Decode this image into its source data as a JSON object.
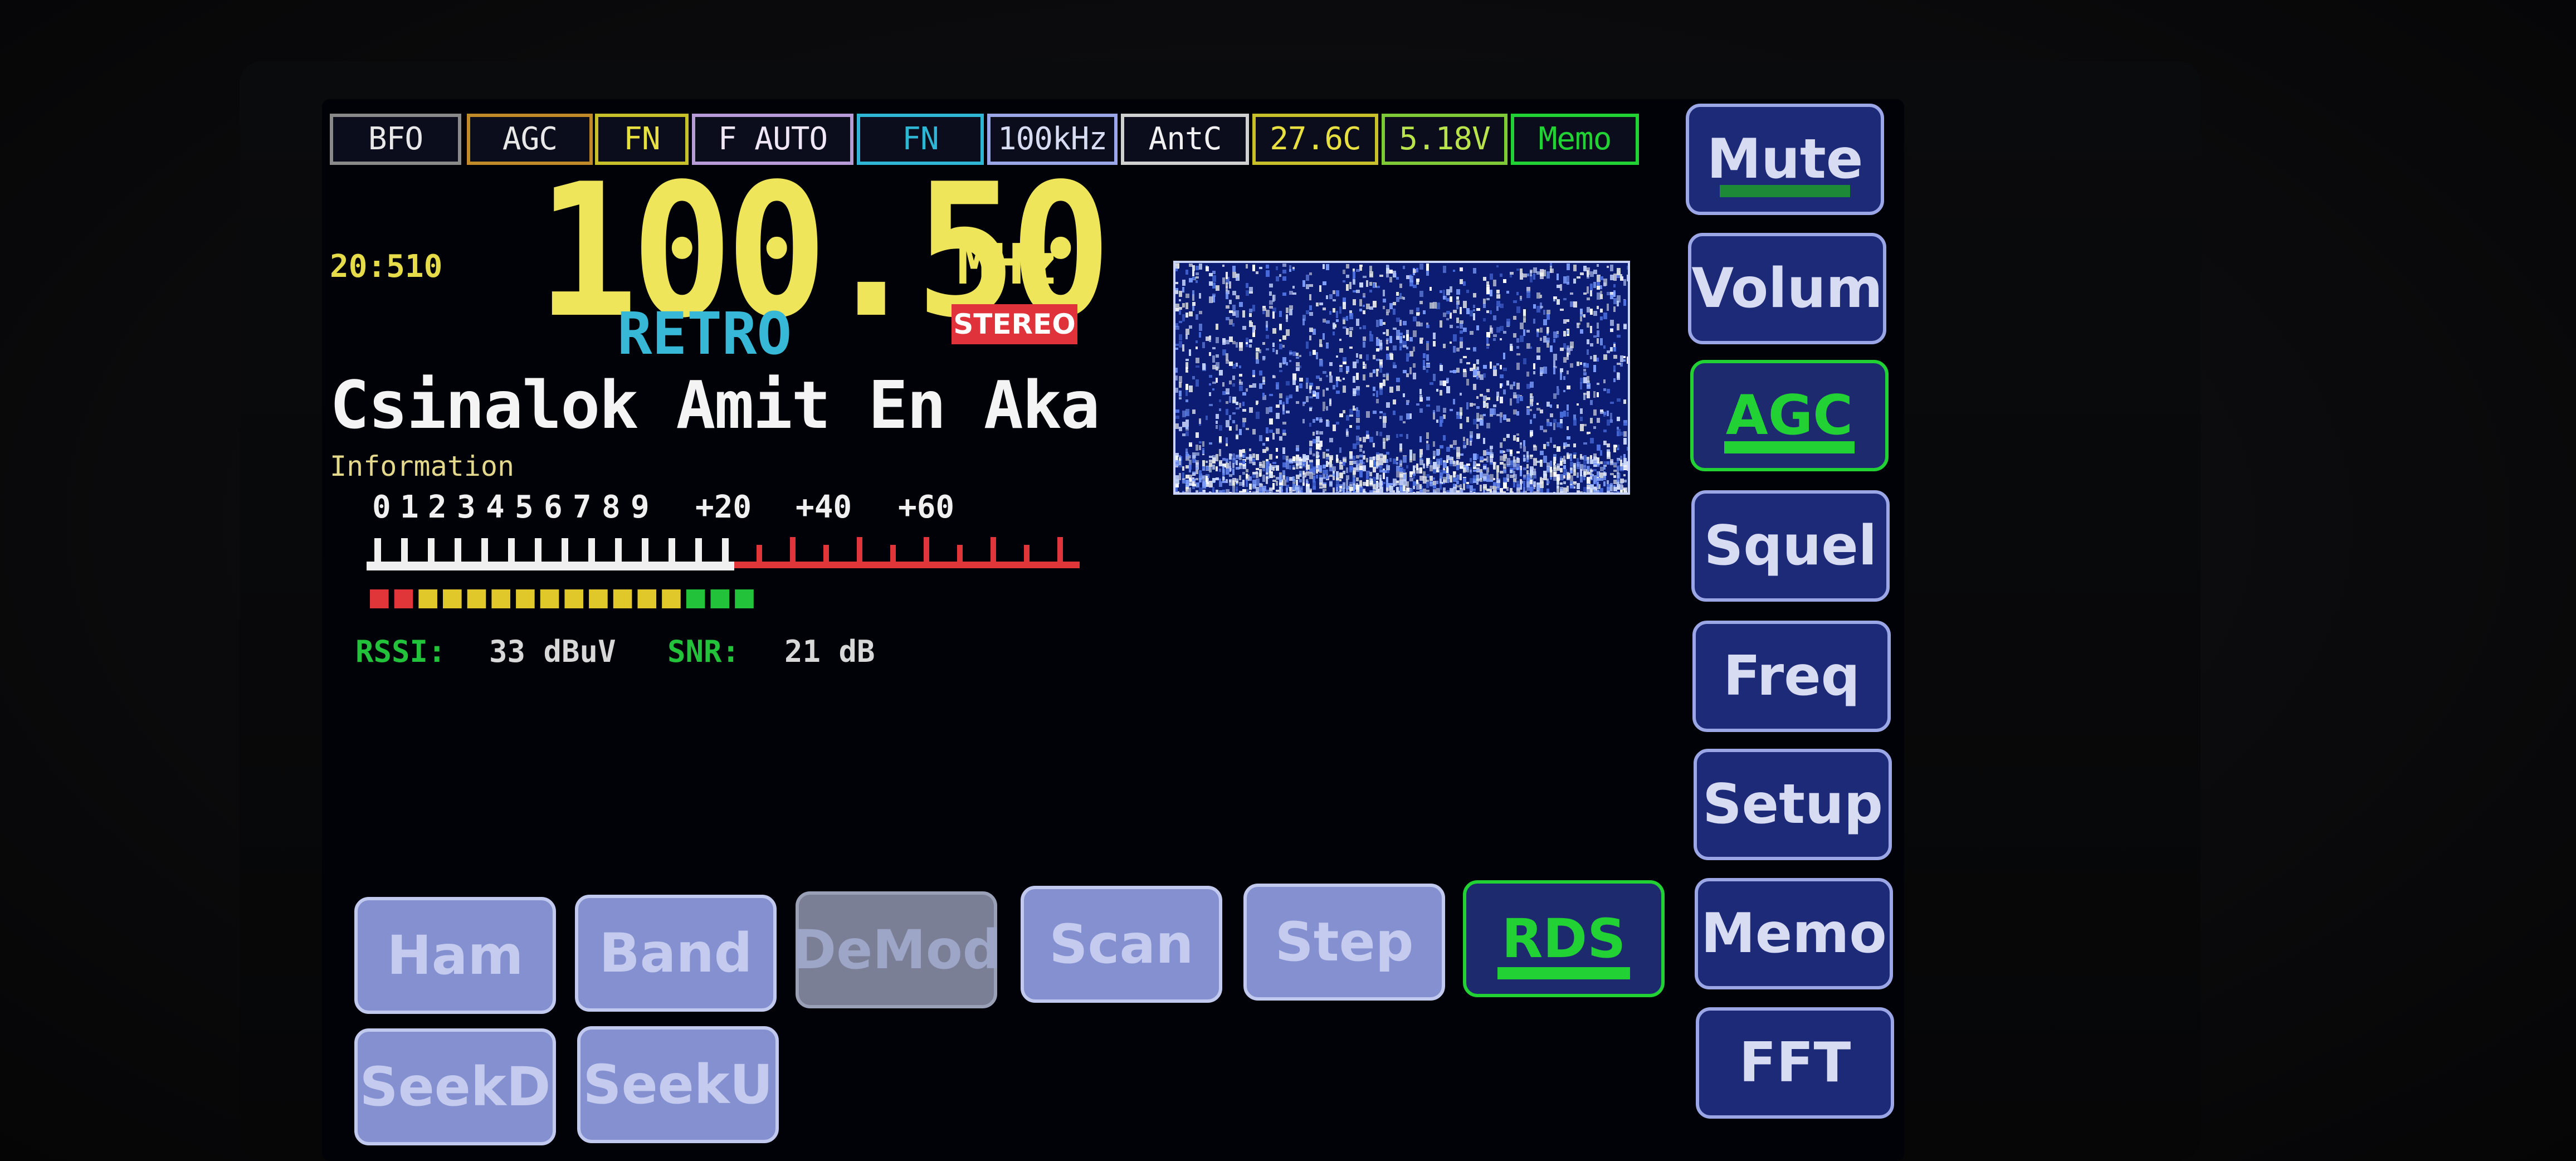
{
  "status_bar": [
    {
      "label": "BFO",
      "color": "#8a8a8a",
      "text_color": "#e8e8e8"
    },
    {
      "label": "AGC",
      "color": "#c08a28",
      "text_color": "#e8e8e8"
    },
    {
      "label": "FN",
      "color": "#c8c02a",
      "text_color": "#e8e040"
    },
    {
      "label": "F AUTO",
      "color": "#b79ad8",
      "text_color": "#efe6f6"
    },
    {
      "label": "FN",
      "color": "#2fb6d4",
      "text_color": "#2fb6d4"
    },
    {
      "label": "100kHz",
      "color": "#9aa6e6",
      "text_color": "#d8dcf2"
    },
    {
      "label": "AntC",
      "color": "#d0d0d0",
      "text_color": "#f0f0f0"
    },
    {
      "label": "27.6C",
      "color": "#c8c02a",
      "text_color": "#e8e040"
    },
    {
      "label": "5.18V",
      "color": "#7fc836",
      "text_color": "#b9e34a"
    },
    {
      "label": "Memo",
      "color": "#22d235",
      "text_color": "#22d235"
    }
  ],
  "time": "20:510",
  "frequency": {
    "value": "100.50",
    "unit": "MHz"
  },
  "station": {
    "name": "RETRO",
    "stereo_label": "STEREO"
  },
  "radiotext": "Csinalok Amit En Aka",
  "info_label": "Information",
  "smeter": {
    "scale_labels": [
      "0",
      "1",
      "2",
      "3",
      "4",
      "5",
      "6",
      "7",
      "8",
      "9",
      "+20",
      "+40",
      "+60"
    ],
    "level_fraction": 0.65
  },
  "signal": {
    "rssi_label": "RSSI:",
    "rssi_value": "33 dBuV",
    "snr_label": "SNR:",
    "snr_value": "21 dB"
  },
  "right_buttons": [
    {
      "id": "mute",
      "label": "Mute",
      "active": false,
      "underline": true
    },
    {
      "id": "volum",
      "label": "Volum",
      "active": false,
      "underline": false
    },
    {
      "id": "agc",
      "label": "AGC",
      "active": true,
      "underline": true
    },
    {
      "id": "squel",
      "label": "Squel",
      "active": false,
      "underline": false
    },
    {
      "id": "freq",
      "label": "Freq",
      "active": false,
      "underline": false
    },
    {
      "id": "setup",
      "label": "Setup",
      "active": false,
      "underline": false
    },
    {
      "id": "memo",
      "label": "Memo",
      "active": false,
      "underline": false
    },
    {
      "id": "fft",
      "label": "FFT",
      "active": false,
      "underline": false
    }
  ],
  "bottom_buttons": [
    {
      "id": "ham",
      "label": "Ham",
      "state": "normal"
    },
    {
      "id": "band",
      "label": "Band",
      "state": "normal"
    },
    {
      "id": "demod",
      "label": "DeMod",
      "state": "disabled"
    },
    {
      "id": "scan",
      "label": "Scan",
      "state": "normal"
    },
    {
      "id": "step",
      "label": "Step",
      "state": "normal"
    },
    {
      "id": "rds",
      "label": "RDS",
      "state": "active"
    },
    {
      "id": "seekd",
      "label": "SeekD",
      "state": "normal"
    },
    {
      "id": "seeku",
      "label": "SeekU",
      "state": "normal"
    }
  ],
  "colors": {
    "accent_green": "#22d235",
    "freq_yellow": "#efe55a",
    "station_cyan": "#37b8d6",
    "stereo_red": "#e0323a"
  }
}
